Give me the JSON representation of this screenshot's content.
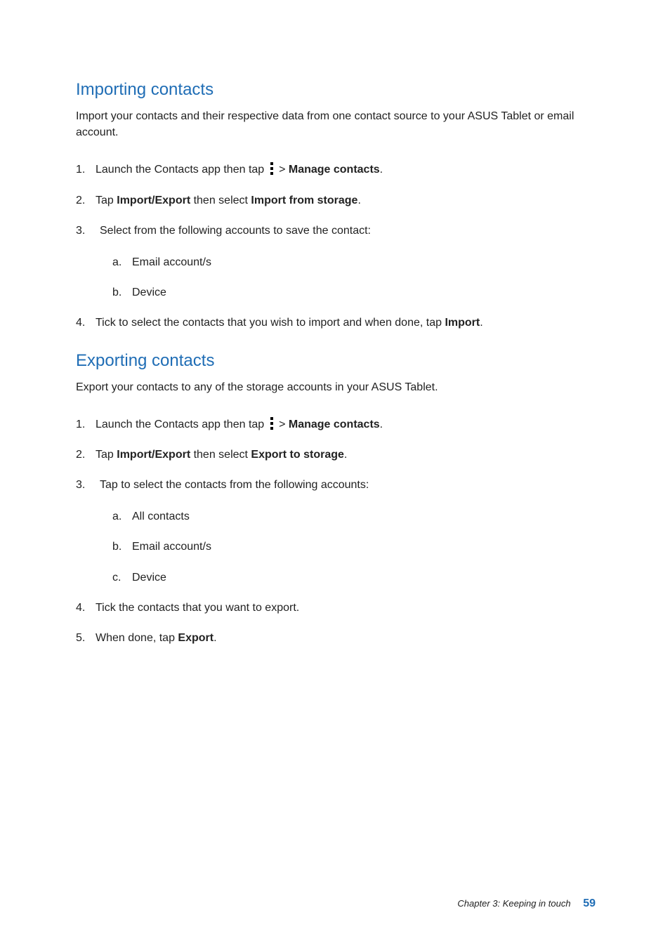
{
  "importing": {
    "heading": "Importing contacts",
    "intro": "Import your contacts and their respective data from one contact source to your ASUS Tablet or email account.",
    "steps": [
      {
        "num": "1.",
        "pre": "Launch the Contacts app then tap ",
        "gt": " > ",
        "bold1": "Manage contacts",
        "post": "."
      },
      {
        "num": "2.",
        "pre": "Tap ",
        "bold1": "Import/Export",
        "mid": " then select ",
        "bold2": "Import from storage",
        "post": "."
      },
      {
        "num": "3.",
        "pre": " Select from the following accounts to save the contact:",
        "sub": [
          {
            "letter": "a.",
            "text": "Email account/s"
          },
          {
            "letter": "b.",
            "text": "Device"
          }
        ]
      },
      {
        "num": "4.",
        "pre": "Tick to select the contacts that you wish to import and when done, tap ",
        "bold1": "Import",
        "post": "."
      }
    ]
  },
  "exporting": {
    "heading": "Exporting contacts",
    "intro": "Export your contacts to any of the storage accounts in your ASUS Tablet.",
    "steps": [
      {
        "num": "1.",
        "pre": "Launch the Contacts app then tap ",
        "gt": " > ",
        "bold1": "Manage contacts",
        "post": "."
      },
      {
        "num": "2.",
        "pre": "Tap ",
        "bold1": "Import/Export",
        "mid": " then select ",
        "bold2": "Export to storage",
        "post": "."
      },
      {
        "num": "3.",
        "pre": " Tap to select the contacts from the following accounts:",
        "sub": [
          {
            "letter": "a.",
            "text": "All contacts"
          },
          {
            "letter": "b.",
            "text": "Email account/s"
          },
          {
            "letter": "c.",
            "text": "Device"
          }
        ]
      },
      {
        "num": "4.",
        "pre": "Tick the contacts that you want to export."
      },
      {
        "num": "5.",
        "pre": "When done, tap ",
        "bold1": "Export",
        "post": "."
      }
    ]
  },
  "footer": {
    "chapter": "Chapter 3: Keeping in touch",
    "page": "59"
  }
}
